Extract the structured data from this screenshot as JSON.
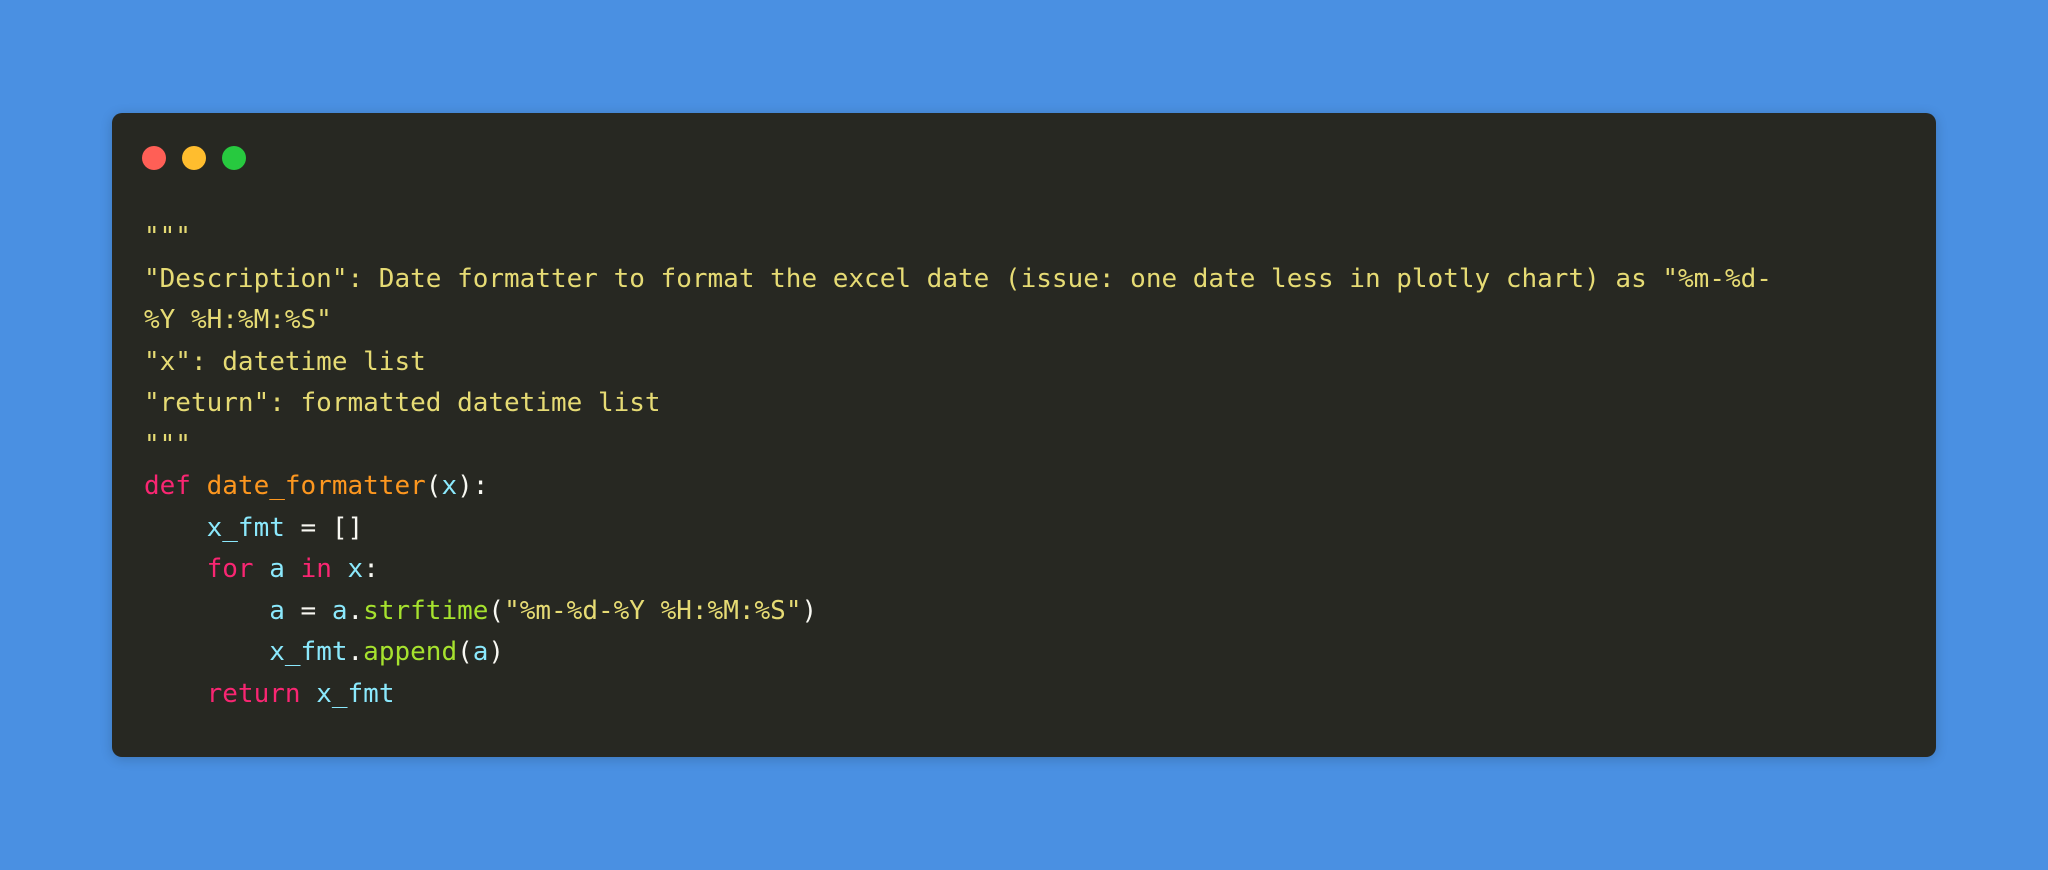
{
  "window": {
    "controls": [
      {
        "name": "close",
        "color": "#ff5f56"
      },
      {
        "name": "minimize",
        "color": "#ffbd2e"
      },
      {
        "name": "maximize",
        "color": "#27c93f"
      }
    ]
  },
  "code": {
    "lines": [
      "\"\"\"",
      "\"Description\": Date formatter to format the excel date (issue: one date less in plotly chart) as \"%m-%d-",
      "%Y %H:%M:%S\"",
      "\"x\": datetime list",
      "\"return\": formatted datetime list",
      "\"\"\""
    ],
    "def_kw": "def",
    "func_name": "date_formatter",
    "paren_open": "(",
    "param": "x",
    "paren_close_colon": "):",
    "l8_var": "x_fmt",
    "l8_rest": " = []",
    "for_kw": "for",
    "loop_var": "a",
    "in_kw": "in",
    "loop_iter": "x",
    "colon": ":",
    "l10_var": "a",
    "l10_eq": " = ",
    "l10_obj": "a",
    "dot": ".",
    "strftime": "strftime",
    "l10_open": "(",
    "l10_str": "\"%m-%d-%Y %H:%M:%S\"",
    "l10_close": ")",
    "l11_obj": "x_fmt",
    "append": "append",
    "l11_open": "(",
    "l11_arg": "a",
    "l11_close": ")",
    "return_kw": "return",
    "return_val": "x_fmt"
  }
}
